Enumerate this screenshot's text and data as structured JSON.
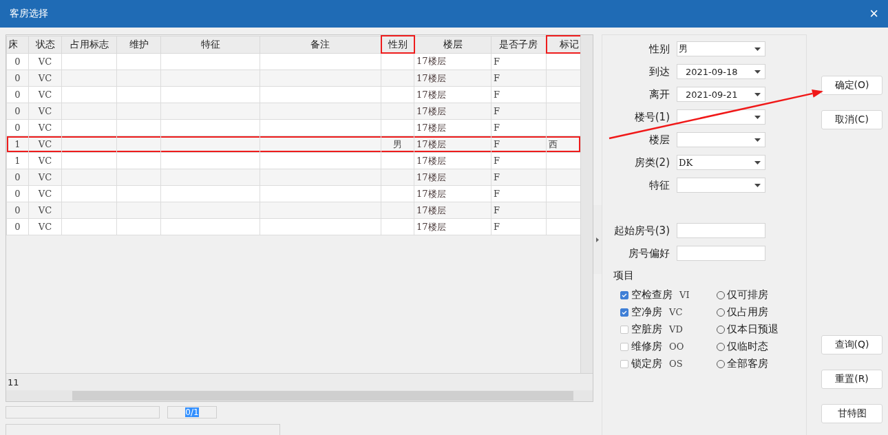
{
  "window": {
    "title": "客房选择",
    "close": "×"
  },
  "table": {
    "columns": [
      {
        "label": "床",
        "highlighted": false
      },
      {
        "label": "状态",
        "highlighted": false
      },
      {
        "label": "占用标志",
        "highlighted": false
      },
      {
        "label": "维护",
        "highlighted": false
      },
      {
        "label": "特征",
        "highlighted": false
      },
      {
        "label": "备注",
        "highlighted": false
      },
      {
        "label": "性别",
        "highlighted": true
      },
      {
        "label": "楼层",
        "highlighted": false
      },
      {
        "label": "是否子房",
        "highlighted": false
      },
      {
        "label": "标记",
        "highlighted": true
      }
    ],
    "rows": [
      {
        "highlighted": false,
        "cells": [
          "0",
          "VC",
          null,
          null,
          null,
          null,
          null,
          "17楼层",
          "F",
          null
        ]
      },
      {
        "highlighted": false,
        "cells": [
          "0",
          "VC",
          null,
          null,
          null,
          null,
          null,
          "17楼层",
          "F",
          null
        ]
      },
      {
        "highlighted": false,
        "cells": [
          "0",
          "VC",
          null,
          null,
          null,
          null,
          null,
          "17楼层",
          "F",
          null
        ]
      },
      {
        "highlighted": false,
        "cells": [
          "0",
          "VC",
          null,
          null,
          null,
          null,
          null,
          "17楼层",
          "F",
          null
        ]
      },
      {
        "highlighted": false,
        "cells": [
          "0",
          "VC",
          null,
          null,
          null,
          null,
          null,
          "17楼层",
          "F",
          null
        ]
      },
      {
        "highlighted": true,
        "cells": [
          "1",
          "VC",
          null,
          null,
          null,
          null,
          "男",
          "17楼层",
          "F",
          "西"
        ]
      },
      {
        "highlighted": false,
        "cells": [
          "1",
          "VC",
          null,
          null,
          null,
          null,
          null,
          "17楼层",
          "F",
          null
        ]
      },
      {
        "highlighted": false,
        "cells": [
          "0",
          "VC",
          null,
          null,
          null,
          null,
          null,
          "17楼层",
          "F",
          null
        ]
      },
      {
        "highlighted": false,
        "cells": [
          "0",
          "VC",
          null,
          null,
          null,
          null,
          null,
          "17楼层",
          "F",
          null
        ]
      },
      {
        "highlighted": false,
        "cells": [
          "0",
          "VC",
          null,
          null,
          null,
          null,
          null,
          "17楼层",
          "F",
          null
        ]
      },
      {
        "highlighted": false,
        "cells": [
          "0",
          "VC",
          null,
          null,
          null,
          null,
          null,
          "17楼层",
          "F",
          null
        ]
      }
    ],
    "footer_count": "11"
  },
  "pager": "0/1",
  "form": [
    {
      "kind": "combo",
      "label": "性别",
      "value": "男",
      "arrow_start": false
    },
    {
      "kind": "combo",
      "label": "到达",
      "value": "2021-09-18",
      "arrow_start": false
    },
    {
      "kind": "combo",
      "label": "离开",
      "value": "2021-09-21",
      "arrow_start": false
    },
    {
      "kind": "combo",
      "label": "楼号(1)",
      "arrow_start": false
    },
    {
      "kind": "combo",
      "label": "楼层",
      "arrow_start": true
    },
    {
      "kind": "combo",
      "label": "房类(2)",
      "value": "DK",
      "arrow_start": false
    },
    {
      "kind": "combo",
      "label": "特征",
      "arrow_start": false
    },
    {
      "kind": "gap"
    },
    {
      "kind": "text",
      "label": "起始房号(3)",
      "arrow_start": false
    },
    {
      "kind": "text",
      "label": "房号偏好",
      "arrow_start": false
    }
  ],
  "items_title": "项目",
  "checkboxes": [
    {
      "label": "空检查房",
      "code": "VI",
      "checked": true
    },
    {
      "label": "空净房",
      "code": "VC",
      "checked": true
    },
    {
      "label": "空脏房",
      "code": "VD",
      "checked": false
    },
    {
      "label": "维修房",
      "code": "OO",
      "checked": false
    },
    {
      "label": "锁定房",
      "code": "OS",
      "checked": false
    }
  ],
  "radios": [
    {
      "label": "仅可排房",
      "selected": false
    },
    {
      "label": "仅占用房",
      "selected": false
    },
    {
      "label": "仅本日预退",
      "selected": false
    },
    {
      "label": "仅临时态",
      "selected": false
    },
    {
      "label": "全部客房",
      "selected": false
    }
  ],
  "buttons_top": [
    {
      "label": "确定(O)",
      "arrow_end": true
    },
    {
      "label": "取消(C)",
      "arrow_end": false
    }
  ],
  "buttons_bottom": [
    {
      "label": "查询(Q)",
      "arrow_end": false
    },
    {
      "label": "重置(R)",
      "arrow_end": false
    },
    {
      "label": "甘特图",
      "arrow_end": false
    }
  ]
}
